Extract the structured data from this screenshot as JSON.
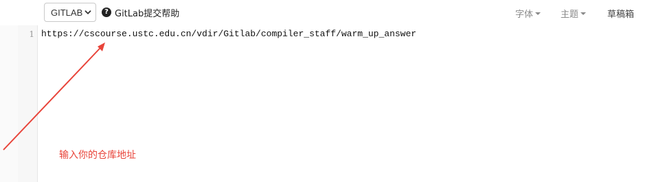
{
  "toolbar": {
    "platform_select": {
      "selected": "GITLAB",
      "options": [
        "GITLAB"
      ]
    },
    "help_label": "GitLab提交帮助",
    "font_menu": "字体",
    "theme_menu": "主题",
    "draft_button": "草稿箱"
  },
  "editor": {
    "line_number": "1",
    "content": "https://cscourse.ustc.edu.cn/vdir/Gitlab/compiler_staff/warm_up_answer"
  },
  "annotation": {
    "text": "输入你的仓库地址",
    "color": "#e8443a"
  }
}
